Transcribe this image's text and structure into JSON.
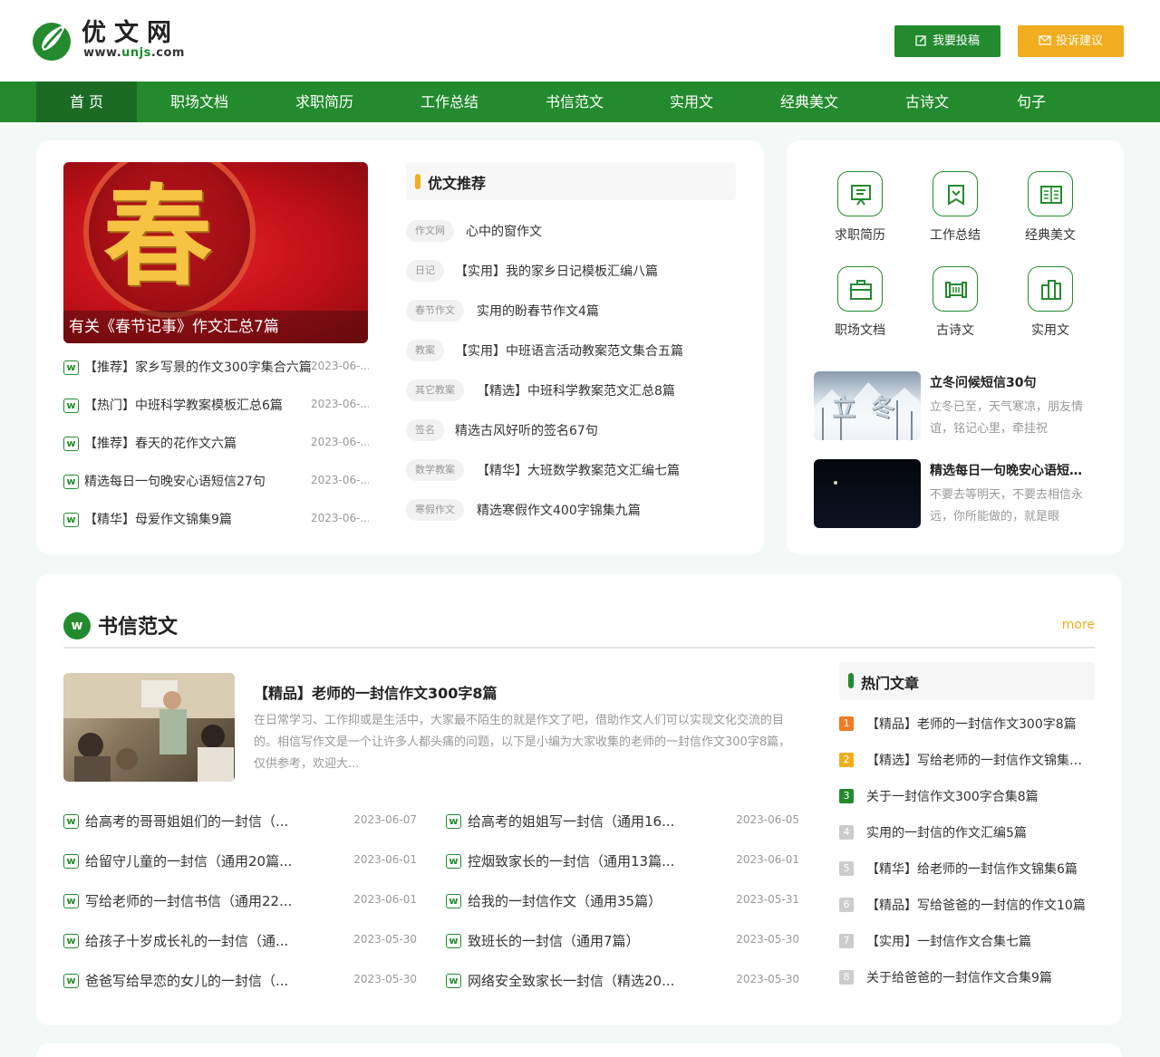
{
  "header": {
    "logo_name": "优文网",
    "logo_url_pre": "www.",
    "logo_url_mid": "unjs",
    "logo_url_post": ".com",
    "submit_label": "我要投稿",
    "complain_label": "投诉建议",
    "colors": {
      "brand_green": "#238b2e",
      "accent_orange": "#f0ad1e"
    }
  },
  "nav": {
    "items": [
      "首 页",
      "职场文档",
      "求职简历",
      "工作总结",
      "书信范文",
      "实用文",
      "经典美文",
      "古诗文",
      "句子"
    ],
    "active": "首 页"
  },
  "hero": {
    "image_label": "春",
    "caption": "有关《春节记事》作文汇总7篇"
  },
  "left_list": [
    {
      "icon": "w",
      "title": "【推荐】家乡写景的作文300字集合六篇",
      "date": "2023-06-..."
    },
    {
      "icon": "w",
      "title": "【热门】中班科学教案模板汇总6篇",
      "date": "2023-06-..."
    },
    {
      "icon": "w",
      "title": "【推荐】春天的花作文六篇",
      "date": "2023-06-..."
    },
    {
      "icon": "w",
      "title": "精选每日一句晚安心语短信27句",
      "date": "2023-06-..."
    },
    {
      "icon": "w",
      "title": "【精华】母爱作文锦集9篇",
      "date": "2023-06-..."
    }
  ],
  "recommend": {
    "title": "优文推荐",
    "items": [
      {
        "tag": "作文网",
        "title": "心中的窗作文"
      },
      {
        "tag": "日记",
        "title": "【实用】我的家乡日记模板汇编八篇"
      },
      {
        "tag": "春节作文",
        "title": "实用的盼春节作文4篇"
      },
      {
        "tag": "教案",
        "title": "【实用】中班语言活动教案范文集合五篇"
      },
      {
        "tag": "其它教案",
        "title": "【精选】中班科学教案范文汇总8篇"
      },
      {
        "tag": "签名",
        "title": "精选古风好听的签名67句"
      },
      {
        "tag": "数学教案",
        "title": "【精华】大班数学教案范文汇编七篇"
      },
      {
        "tag": "寒假作文",
        "title": "精选寒假作文400字锦集九篇"
      }
    ]
  },
  "categories": [
    {
      "label": "求职简历",
      "icon": "resume-icon"
    },
    {
      "label": "工作总结",
      "icon": "summary-icon"
    },
    {
      "label": "经典美文",
      "icon": "book-icon"
    },
    {
      "label": "职场文档",
      "icon": "briefcase-icon"
    },
    {
      "label": "古诗文",
      "icon": "scroll-icon"
    },
    {
      "label": "实用文",
      "icon": "documents-icon"
    }
  ],
  "side_news": [
    {
      "image_label": "立 冬",
      "title": "立冬问候短信30句",
      "desc": "立冬已至，天气寒凉，朋友情谊，铭记心里，牵挂祝"
    },
    {
      "image_label": "",
      "title": "精选每日一句晚安心语短信27句",
      "desc": "不要去等明天，不要去相信永远，你所能做的，就是眼"
    }
  ],
  "letters": {
    "icon": "w",
    "title": "书信范文",
    "more": "more",
    "featured": {
      "title": "【精品】老师的一封信作文300字8篇",
      "desc": "在日常学习、工作抑或是生活中，大家最不陌生的就是作文了吧，借助作文人们可以实现文化交流的目的。相信写作文是一个让许多人都头痛的问题，以下是小编为大家收集的老师的一封信作文300字8篇，仅供参考，欢迎大..."
    },
    "col1": [
      {
        "title": "给高考的哥哥姐姐们的一封信（...",
        "date": "2023-06-07"
      },
      {
        "title": "给留守儿童的一封信（通用20篇...",
        "date": "2023-06-01"
      },
      {
        "title": "写给老师的一封信书信（通用22...",
        "date": "2023-06-01"
      },
      {
        "title": "给孩子十岁成长礼的一封信（通...",
        "date": "2023-05-30"
      },
      {
        "title": "爸爸写给早恋的女儿的一封信（...",
        "date": "2023-05-30"
      }
    ],
    "col2": [
      {
        "title": "给高考的姐姐写一封信（通用16...",
        "date": "2023-06-05"
      },
      {
        "title": "控烟致家长的一封信（通用13篇...",
        "date": "2023-06-01"
      },
      {
        "title": "给我的一封信作文（通用35篇）",
        "date": "2023-05-31"
      },
      {
        "title": "致班长的一封信（通用7篇）",
        "date": "2023-05-30"
      },
      {
        "title": "网络安全致家长一封信（精选20...",
        "date": "2023-05-30"
      }
    ],
    "hot": {
      "title": "热门文章",
      "items": [
        {
          "num": "1",
          "title": "【精品】老师的一封信作文300字8篇",
          "color": "#f07b22"
        },
        {
          "num": "2",
          "title": "【精选】写给老师的一封信作文锦集十篇",
          "color": "#f0ad1e"
        },
        {
          "num": "3",
          "title": "关于一封信作文300字合集8篇",
          "color": "#238b2e"
        },
        {
          "num": "4",
          "title": "实用的一封信的作文汇编5篇",
          "color": "#cccccc"
        },
        {
          "num": "5",
          "title": "【精华】给老师的一封信作文锦集6篇",
          "color": "#cccccc"
        },
        {
          "num": "6",
          "title": "【精品】写给爸爸的一封信的作文10篇",
          "color": "#cccccc"
        },
        {
          "num": "7",
          "title": "【实用】一封信作文合集七篇",
          "color": "#cccccc"
        },
        {
          "num": "8",
          "title": "关于给爸爸的一封信作文合集9篇",
          "color": "#cccccc"
        }
      ]
    }
  }
}
